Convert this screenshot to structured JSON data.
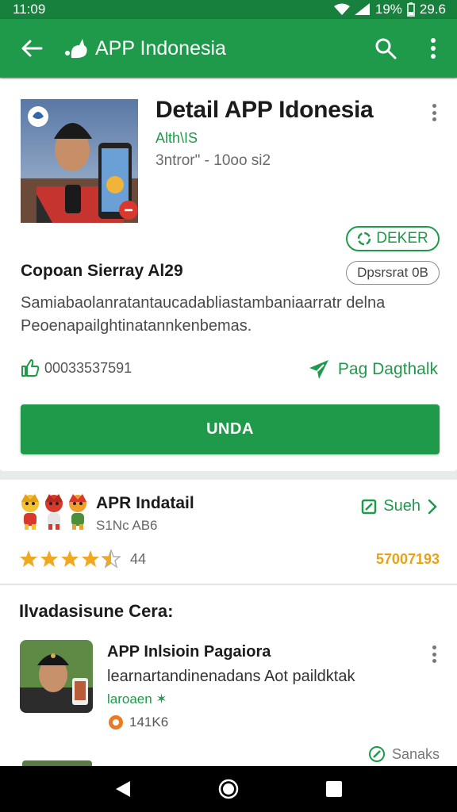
{
  "status_bar": {
    "time": "11:09",
    "battery": "19%",
    "extra": "29.6"
  },
  "app_bar": {
    "title": "APP Indonesia",
    "icons": [
      "back-arrow-icon",
      "leaf-logo-icon",
      "search-icon",
      "more-vert-icon"
    ]
  },
  "detail": {
    "title": "Detail APP Idonesia",
    "developer": "Alth\\IS",
    "meta": "3ntror\" - 10oo si2",
    "chip_green": "DEKER",
    "chip_grey": "Dpsrsrat 0B",
    "subheading": "Copoan Sierray Al29",
    "description_line1": "Samiabaolanratantaucadabliastambaniaarratr delna",
    "description_line2": "Peoenapailghtinatannkenbemas.",
    "likes": "00033537591",
    "page_link": "Pag Dagthalk",
    "install_button": "UNDA"
  },
  "rating_card": {
    "title": "APR Indatail",
    "subtitle": "S1Nc AB6",
    "link": "Sueh",
    "rating_stars": 4.5,
    "rating_count": "44",
    "number": "57007193"
  },
  "section": {
    "title": "Ilvadasisune Cera:",
    "item": {
      "title": "APP Inlsioin Pagaiora",
      "description": "learnartandinenadans Aot paildktak",
      "tag": "laroaen ✶",
      "meta": "141K6",
      "link": "Sanaks"
    }
  },
  "colors": {
    "brand_green": "#1e9a4a",
    "status_green": "#17803c",
    "accent_orange": "#e7a318"
  }
}
